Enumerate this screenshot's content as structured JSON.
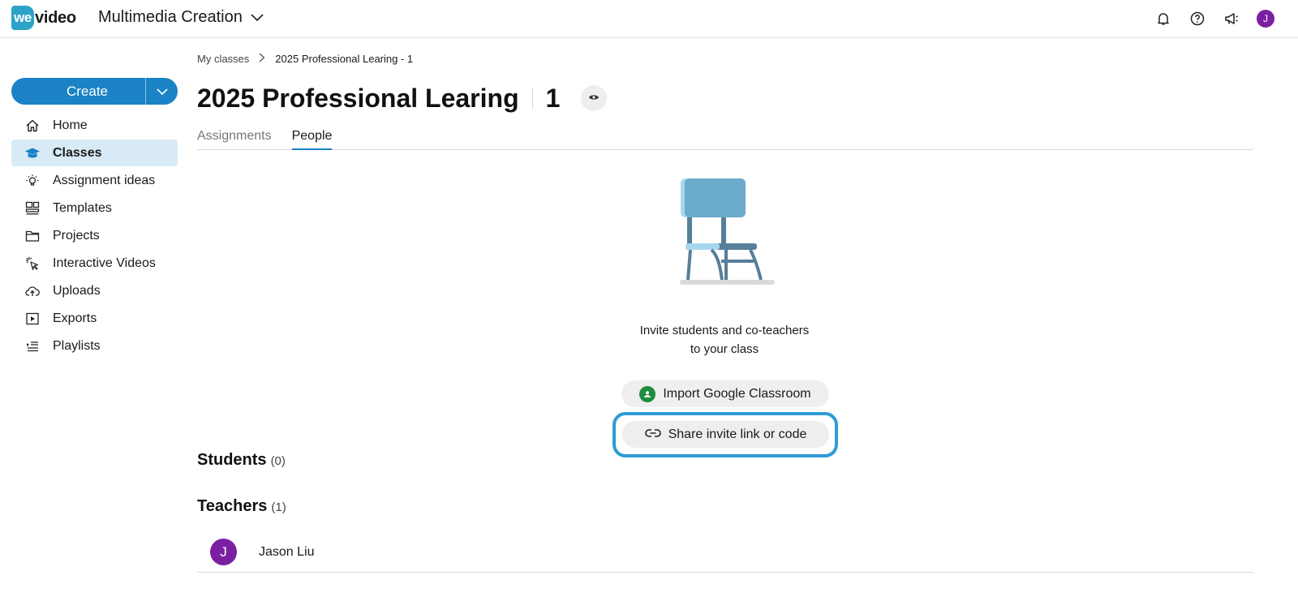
{
  "app": {
    "logo_we": "we",
    "logo_video": "video",
    "workspace_name": "Multimedia Creation",
    "user_initial": "J"
  },
  "sidebar": {
    "create_label": "Create",
    "items": [
      {
        "label": "Home",
        "icon": "home-icon"
      },
      {
        "label": "Classes",
        "icon": "graduation-cap-icon",
        "active": true
      },
      {
        "label": "Assignment ideas",
        "icon": "lightbulb-icon"
      },
      {
        "label": "Templates",
        "icon": "templates-icon"
      },
      {
        "label": "Projects",
        "icon": "folder-icon"
      },
      {
        "label": "Interactive Videos",
        "icon": "interactive-cursor-icon"
      },
      {
        "label": "Uploads",
        "icon": "cloud-upload-icon"
      },
      {
        "label": "Exports",
        "icon": "export-play-icon"
      },
      {
        "label": "Playlists",
        "icon": "playlist-icon"
      }
    ]
  },
  "breadcrumb": {
    "parent": "My classes",
    "current": "2025 Professional Learing - 1"
  },
  "class": {
    "title": "2025 Professional Learing",
    "count": "1"
  },
  "tabs": [
    {
      "label": "Assignments",
      "active": false
    },
    {
      "label": "People",
      "active": true
    }
  ],
  "empty_state": {
    "line1": "Invite students and co-teachers",
    "line2": "to your class",
    "import_button": "Import Google Classroom",
    "share_button": "Share invite link or code"
  },
  "students": {
    "title": "Students",
    "count": "(0)"
  },
  "teachers": {
    "title": "Teachers",
    "count": "(1)",
    "list": [
      {
        "initial": "J",
        "name": "Jason Liu"
      }
    ]
  },
  "colors": {
    "brand": "#2ea3c9",
    "accent": "#1a82c5",
    "highlight": "#2f9bd6",
    "avatar": "#7a1fa2",
    "active_nav_bg": "#d8eaf6"
  }
}
